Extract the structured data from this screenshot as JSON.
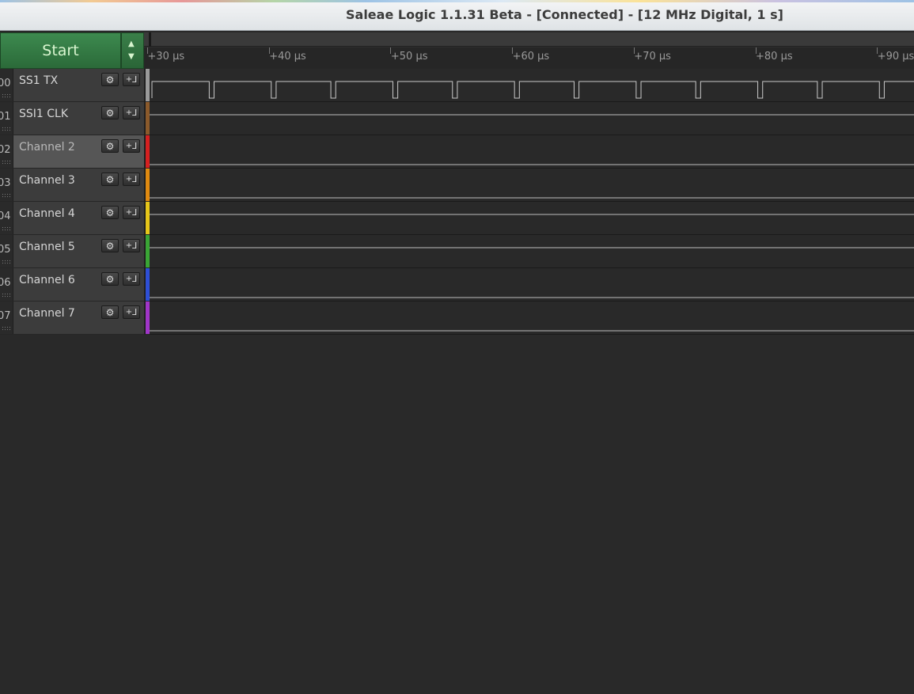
{
  "window": {
    "title": "Saleae Logic 1.1.31 Beta - [Connected] - [12 MHz Digital, 1 s]"
  },
  "toolbar": {
    "start_label": "Start"
  },
  "ruler": {
    "unit": "μs",
    "ticks": [
      "+30 μs",
      "+40 μs",
      "+50 μs",
      "+60 μs",
      "+70 μs",
      "+80 μs",
      "+90 μs"
    ]
  },
  "channels": [
    {
      "num": "00",
      "name": "SS1 TX",
      "color": "#9a9a9a",
      "idle": "high",
      "selected": false
    },
    {
      "num": "01",
      "name": "SSI1 CLK",
      "color": "#8b5a2b",
      "idle": "high",
      "selected": false
    },
    {
      "num": "02",
      "name": "Channel 2",
      "color": "#d62020",
      "idle": "low",
      "selected": true
    },
    {
      "num": "03",
      "name": "Channel 3",
      "color": "#e08a10",
      "idle": "low",
      "selected": false
    },
    {
      "num": "04",
      "name": "Channel 4",
      "color": "#e6c619",
      "idle": "high",
      "selected": false
    },
    {
      "num": "05",
      "name": "Channel 5",
      "color": "#3aa535",
      "idle": "high",
      "selected": false
    },
    {
      "num": "06",
      "name": "Channel 6",
      "color": "#2e4fd6",
      "idle": "low",
      "selected": false
    },
    {
      "num": "07",
      "name": "Channel 7",
      "color": "#a035c8",
      "idle": "low",
      "selected": false
    }
  ],
  "icons": {
    "gear": "gear-icon",
    "trigger": "trigger-icon",
    "up": "arrow-up-icon",
    "down": "arrow-down-icon"
  },
  "signal": {
    "ch0_falling_edges_us": [
      30.1,
      35.2,
      40.1,
      45.2,
      50.1,
      55.2,
      60.1,
      65.2,
      70.1,
      75.2,
      80.1,
      85.2,
      90.1
    ],
    "ch0_low_width_us": 0.4
  }
}
